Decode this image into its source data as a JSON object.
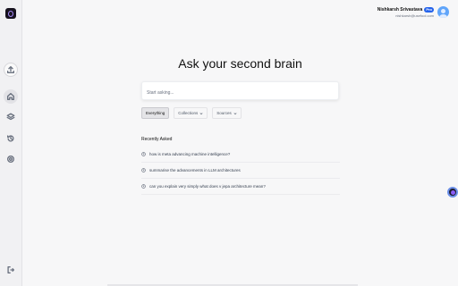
{
  "app": {
    "logo": "brain-logo"
  },
  "sidebar": {
    "items": [
      {
        "name": "upload",
        "icon": "upload-icon"
      },
      {
        "name": "home",
        "icon": "home-icon",
        "active": true
      },
      {
        "name": "collections",
        "icon": "layers-icon"
      },
      {
        "name": "history",
        "icon": "history-icon"
      },
      {
        "name": "help",
        "icon": "help-icon"
      },
      {
        "name": "logout",
        "icon": "logout-icon"
      }
    ]
  },
  "user": {
    "name": "Nishkarsh Srivastava",
    "badge": "Pro",
    "email": "nishkarsh@usefool.com"
  },
  "main": {
    "title": "Ask your second brain",
    "search": {
      "placeholder": "Start asking...",
      "value": ""
    },
    "filters": {
      "everything": "Everything",
      "collections": "Collections",
      "sources": "Sources"
    },
    "recent": {
      "title": "Recently Asked",
      "items": [
        "how is meta advancing machine intelligence?",
        "summarise the advancements in LLM architectures",
        "can you explain very simply what does v jepa architecture mean?"
      ]
    }
  },
  "colors": {
    "accent": "#2563eb",
    "logo_ring": "#a78bfa",
    "avatar": "#60a5fa"
  }
}
